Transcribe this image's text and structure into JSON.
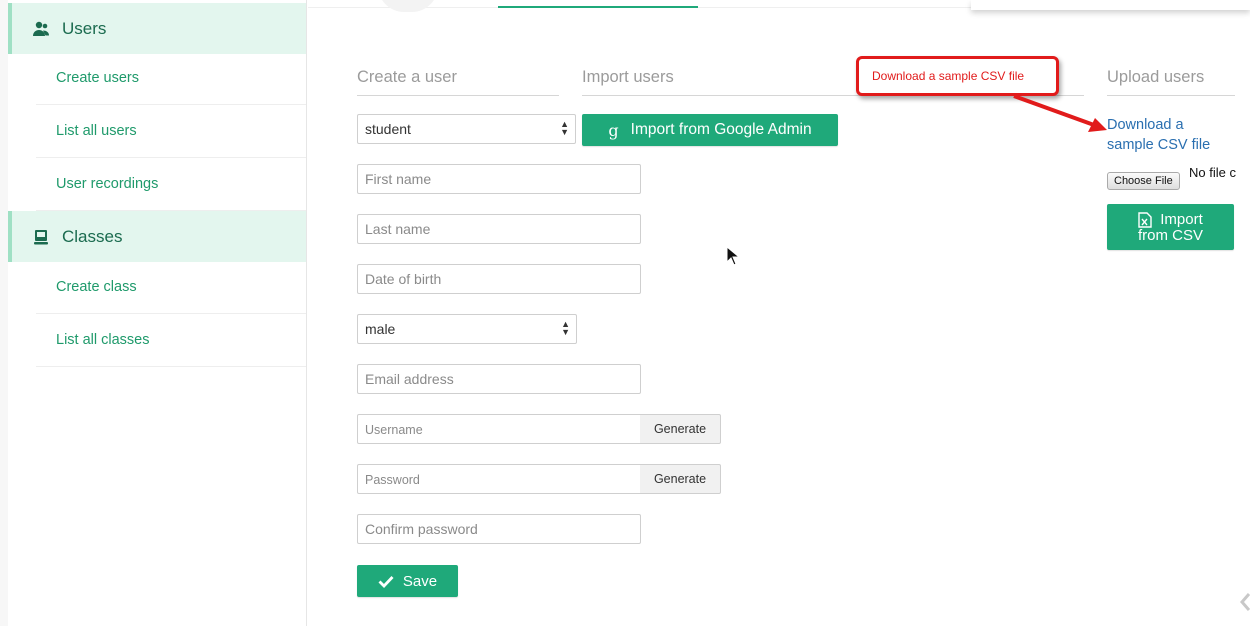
{
  "sidebar": {
    "sections": [
      {
        "label": "Users",
        "icon": "users-icon",
        "items": [
          "Create users",
          "List all users",
          "User recordings"
        ]
      },
      {
        "label": "Classes",
        "icon": "classes-icon",
        "items": [
          "Create class",
          "List all classes"
        ]
      }
    ]
  },
  "columns": {
    "create": "Create a user",
    "import": "Import users",
    "upload": "Upload users"
  },
  "form": {
    "role_value": "student",
    "gender_value": "male",
    "first_name_placeholder": "First name",
    "last_name_placeholder": "Last name",
    "dob_placeholder": "Date of birth",
    "email_placeholder": "Email address",
    "username_placeholder": "Username",
    "password_placeholder": "Password",
    "confirm_password_placeholder": "Confirm password",
    "generate_label": "Generate",
    "save_label": "Save"
  },
  "import": {
    "google_label": "Import from Google Admin"
  },
  "upload": {
    "download_link": "Download a sample CSV file",
    "choose_file_label": "Choose File",
    "no_file_text": "No file chosen",
    "import_csv_label_line1": "Import",
    "import_csv_label_line2": "from CSV"
  },
  "annotation": {
    "text": "Download a sample CSV file"
  },
  "colors": {
    "accent": "#1fa97a",
    "link": "#2a6fb0",
    "annotation": "#e11b1b",
    "sidebar_active": "#e3f6ee"
  }
}
